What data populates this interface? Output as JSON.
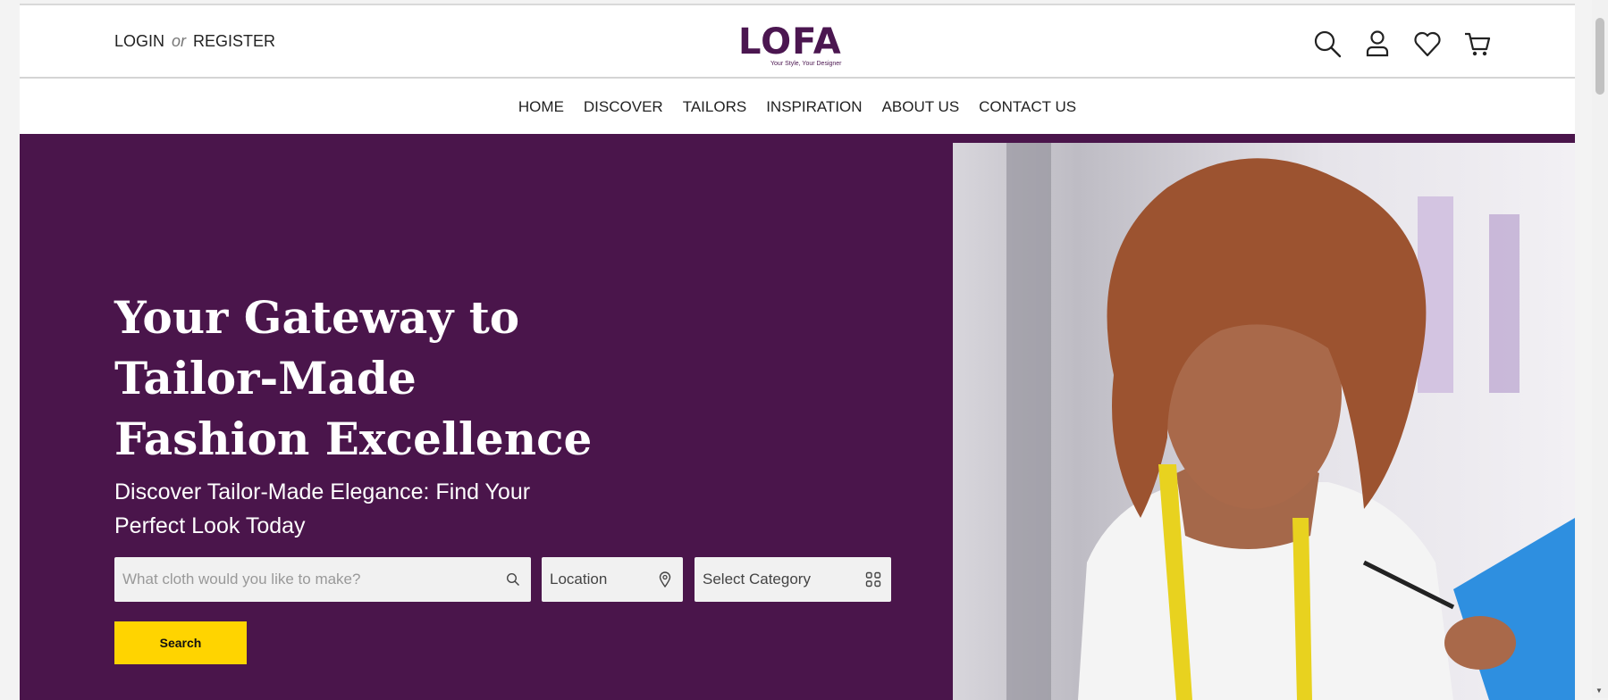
{
  "header": {
    "login": "LOGIN",
    "or": "or",
    "register": "REGISTER",
    "logo_text": "LOFA",
    "logo_tagline": "Your Style, Your Designer",
    "icons": [
      "search-icon",
      "user-icon",
      "heart-icon",
      "cart-icon"
    ]
  },
  "nav": {
    "items": [
      "HOME",
      "DISCOVER",
      "TAILORS",
      "INSPIRATION",
      "ABOUT US",
      "CONTACT US"
    ]
  },
  "hero": {
    "title": "Your Gateway to Tailor-Made Fashion Excellence",
    "subtitle": "Discover Tailor-Made Elegance: Find Your Perfect Look Today",
    "search_placeholder": "What cloth would you like to make?",
    "location_value": "Location",
    "category_value": "Select Category",
    "search_button": "Search",
    "background_color": "#4a154b",
    "button_color": "#ffd400"
  }
}
